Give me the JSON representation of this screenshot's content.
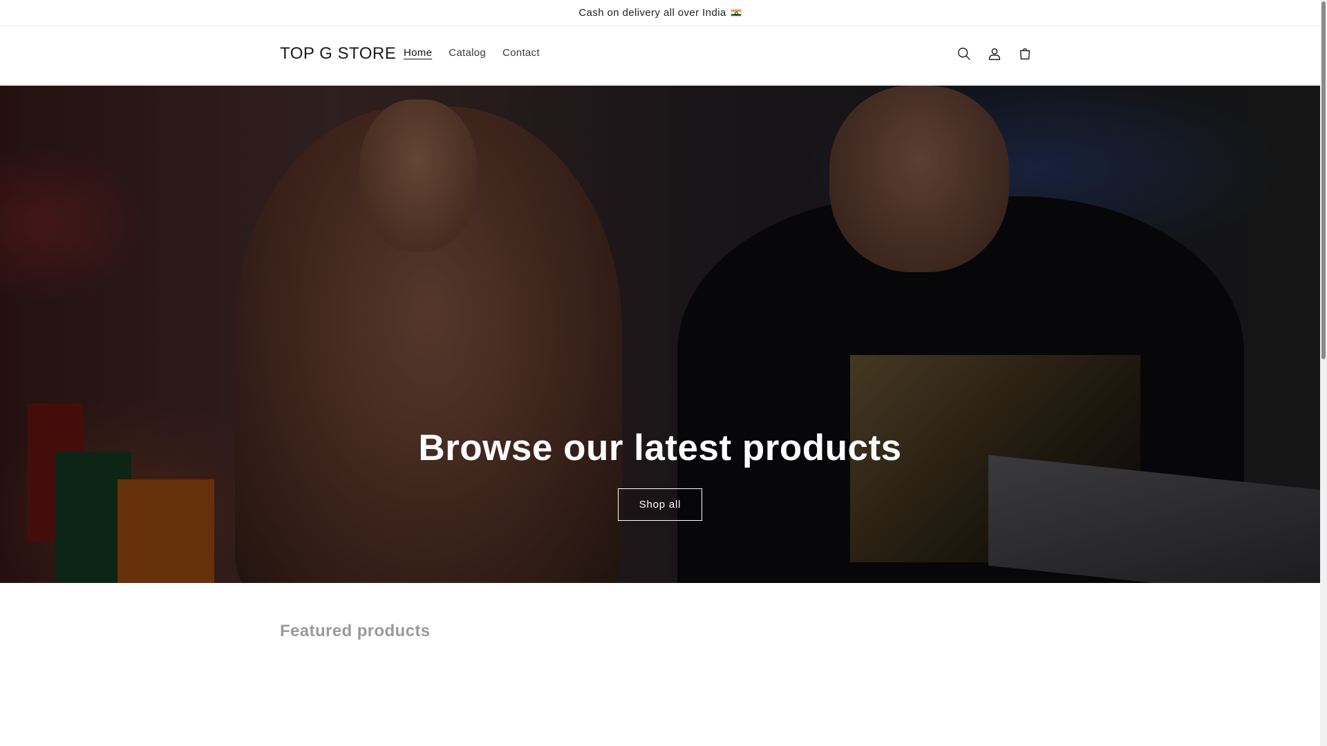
{
  "announcement": {
    "text": "Cash on delivery all over India"
  },
  "header": {
    "logo": "TOP G STORE",
    "nav": [
      {
        "label": "Home",
        "active": true
      },
      {
        "label": "Catalog",
        "active": false
      },
      {
        "label": "Contact",
        "active": false
      }
    ],
    "icons": [
      "search-icon",
      "account-icon",
      "cart-icon"
    ]
  },
  "hero": {
    "title": "Browse our latest products",
    "button_label": "Shop all"
  },
  "featured": {
    "title": "Featured products"
  },
  "colors": {
    "text": "#121212",
    "muted": "#9a9a9a",
    "hero_text": "#ffffff"
  }
}
